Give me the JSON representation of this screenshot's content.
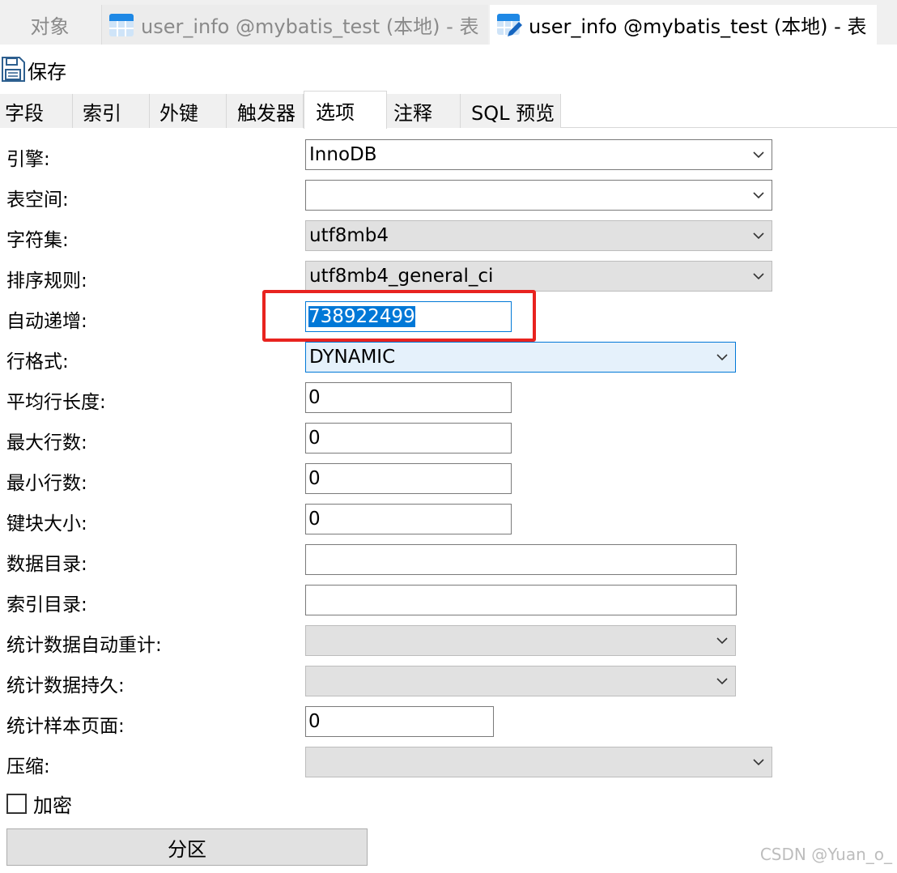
{
  "tabs": {
    "objects_label": "对象",
    "tab1_label": "user_info @mybatis_test (本地) - 表",
    "tab2_label": "user_info @mybatis_test (本地) - 表"
  },
  "toolbar": {
    "save_label": "保存"
  },
  "subtabs": [
    {
      "label": "字段"
    },
    {
      "label": "索引"
    },
    {
      "label": "外键"
    },
    {
      "label": "触发器"
    },
    {
      "label": "选项"
    },
    {
      "label": "注释"
    },
    {
      "label": "SQL 预览"
    }
  ],
  "active_subtab": "选项",
  "options": {
    "engine": {
      "label": "引擎:",
      "value": "InnoDB"
    },
    "tablespace": {
      "label": "表空间:",
      "value": ""
    },
    "charset": {
      "label": "字符集:",
      "value": "utf8mb4"
    },
    "collation": {
      "label": "排序规则:",
      "value": "utf8mb4_general_ci"
    },
    "auto_increment": {
      "label": "自动递增:",
      "value": "738922499"
    },
    "row_format": {
      "label": "行格式:",
      "value": "DYNAMIC"
    },
    "avg_row_length": {
      "label": "平均行长度:",
      "value": "0"
    },
    "max_rows": {
      "label": "最大行数:",
      "value": "0"
    },
    "min_rows": {
      "label": "最小行数:",
      "value": "0"
    },
    "key_block_size": {
      "label": "键块大小:",
      "value": "0"
    },
    "data_directory": {
      "label": "数据目录:",
      "value": ""
    },
    "index_directory": {
      "label": "索引目录:",
      "value": ""
    },
    "stats_auto_recalc": {
      "label": "统计数据自动重计:",
      "value": ""
    },
    "stats_persistent": {
      "label": "统计数据持久:",
      "value": ""
    },
    "stats_sample_pages": {
      "label": "统计样本页面:",
      "value": "0"
    },
    "compression": {
      "label": "压缩:",
      "value": ""
    },
    "encryption": {
      "label": "加密",
      "checked": false
    }
  },
  "partition_button_label": "分区",
  "watermark": "CSDN @Yuan_o_",
  "colors": {
    "accent": "#0078d7",
    "highlight_box": "#e8231f",
    "icon_blue": "#1e88e5"
  },
  "icons": {
    "table_icon": "table-icon",
    "table_edit_icon": "table-edit-icon",
    "save_icon": "floppy-disk-icon",
    "dropdown": "chevron-down-icon"
  }
}
